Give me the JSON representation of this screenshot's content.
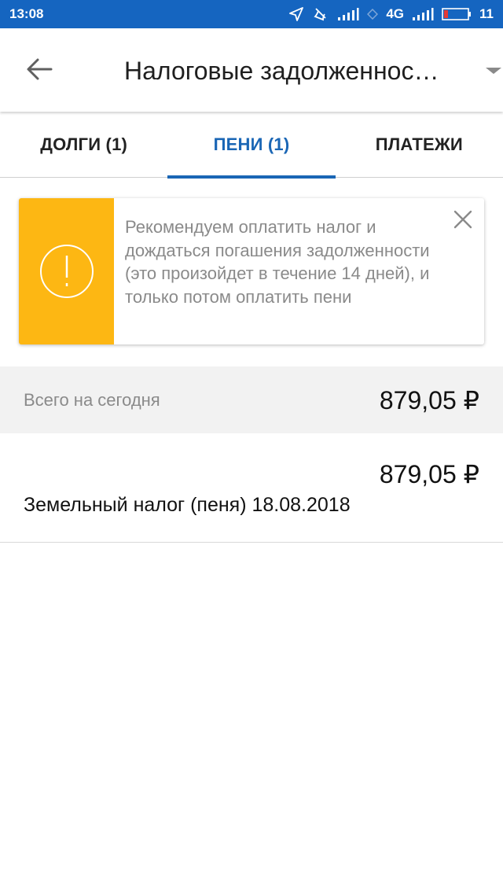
{
  "status_bar": {
    "time": "13:08",
    "network": "4G",
    "battery": "11"
  },
  "app_bar": {
    "title": "Налоговые задолженнос…"
  },
  "tabs": [
    {
      "label": "ДОЛГИ (1)",
      "active": false
    },
    {
      "label": "ПЕНИ (1)",
      "active": true
    },
    {
      "label": "ПЛАТЕЖИ",
      "active": false
    }
  ],
  "notice": {
    "text": "Рекомендуем оплатить налог и дождаться погашения задолженности (это произойдет в течение 14 дней), и только потом оплатить пени",
    "accent_color": "#fdb713"
  },
  "total": {
    "label": "Всего на сегодня",
    "amount": "879,05 ₽"
  },
  "items": [
    {
      "amount": "879,05 ₽",
      "name": "Земельный налог (пеня) 18.08.2018"
    }
  ],
  "colors": {
    "status_bar": "#1565c0",
    "accent": "#1a66b5"
  }
}
